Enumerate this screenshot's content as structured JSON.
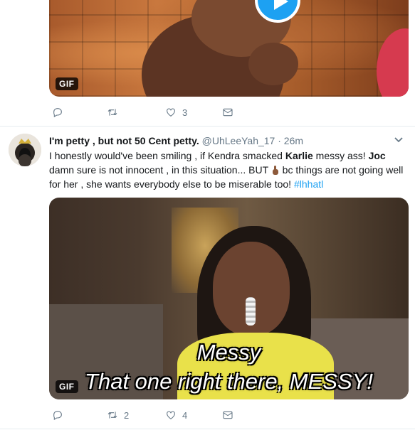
{
  "tweet1": {
    "media": {
      "type_badge": "GIF"
    },
    "actions": {
      "reply_icon": "reply-icon",
      "retweet_icon": "retweet-icon",
      "like_icon": "heart-icon",
      "like_count": "3",
      "dm_icon": "envelope-icon"
    }
  },
  "tweet2": {
    "author": {
      "display_name": "I'm petty , but not 50 Cent petty.",
      "handle": "@UhLeeYah_17",
      "separator": "·",
      "time": "26m"
    },
    "text": {
      "part1": "I honestly would've been smiling , if Kendra smacked ",
      "bold1": "Karlie",
      "part2": " messy ass! ",
      "bold2": "Joc",
      "part3": " damn sure is not innocent , in this situation... BUT ",
      "part4": " bc things are not going well for her , she wants everybody else to be miserable too! ",
      "hashtag": "#lhhatl"
    },
    "media": {
      "type_badge": "GIF",
      "caption_line1": "Messy",
      "caption_line2": "That one right there, MESSY!"
    },
    "actions": {
      "reply_icon": "reply-icon",
      "retweet_icon": "retweet-icon",
      "retweet_count": "2",
      "like_icon": "heart-icon",
      "like_count": "4",
      "dm_icon": "envelope-icon"
    }
  },
  "colors": {
    "accent": "#1da1f2",
    "muted": "#657786",
    "text": "#14171a",
    "divider": "#e6ecf0"
  }
}
